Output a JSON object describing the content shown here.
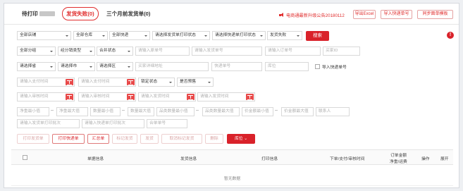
{
  "tabs": {
    "pending_print": "待打印",
    "ship_fail": "发货失败(0)",
    "three_months": "三个月前发货单(0)"
  },
  "notice": "电商通最新升级公告20180112",
  "header_buttons": {
    "export": "导出Excel",
    "import": "导入快递单号",
    "sync": "同步面单模板"
  },
  "row1": {
    "shop": "全部店铺",
    "warehouse": "全部仓库",
    "express": "全部快递",
    "ship_print_status": "请选择发货单打印状态",
    "express_print_status": "请选择快递单打印状态",
    "ship_status": "发货失败",
    "search": "搜索"
  },
  "row2": {
    "group": "全部分组",
    "deal_type": "经分销类型",
    "merge_status": "合并状态",
    "ph_receipt": "请输入原单号",
    "ph_ship_no": "请输入发货单号",
    "ph_order_no": "请输入订单号",
    "ph_buyer_id": "买家ID"
  },
  "row3": {
    "province": "请选择省",
    "city": "请选择市",
    "district": "请选择区",
    "ph_address": "买家详细地址",
    "ph_express_no": "快递单号",
    "ph_location": "库位",
    "import_label": "导入快递单号"
  },
  "row4": {
    "ph_pay_start": "请输入支付时间",
    "ph_pay_end": "请输入支付时间",
    "lock_status": "锁定状态",
    "presale": "是否预售"
  },
  "row5": {
    "ph_audit_start": "请输入审核时间",
    "ph_audit_end": "请输入审核时间",
    "ph_ship_start": "请输入发货时间",
    "ph_ship_end": "请输入发货时间"
  },
  "row6": {
    "ph_sku_min": "净重最小值",
    "ph_sku_max": "净重最大值",
    "ph_qty_min": "数量最小值",
    "ph_qty_max": "数量最大值",
    "ph_goods_min": "品类数量最小值",
    "ph_goods_max": "品类数量最大值",
    "ph_price_min": "价金额最小值",
    "ph_price_max": "价金额最大值",
    "ph_contact": "联系人"
  },
  "row7": {
    "ph_ship_batch": "请输入发货单打印批次",
    "ph_express_batch": "请输入快递单打印批次",
    "ph_merge_no": "合单单号"
  },
  "actions": {
    "print_ship": "打印发货单",
    "print_express": "打印快递单",
    "summary": "汇总单",
    "mark_shipped": "标记发货",
    "ship": "发货",
    "cancel_mark": "取消标记发货",
    "delete": "删除",
    "location": "库位"
  },
  "table": {
    "headers": {
      "goods": "单据信息",
      "ship_info": "发货信息",
      "print_info": "打印信息",
      "order_time": "下单/支付/审核时间",
      "order_amount": "订单金额",
      "freight": "净重/运费",
      "operation": "操作",
      "expand": "展开"
    },
    "empty": "暂无数据"
  },
  "colors": {
    "accent": "#d9222a"
  }
}
